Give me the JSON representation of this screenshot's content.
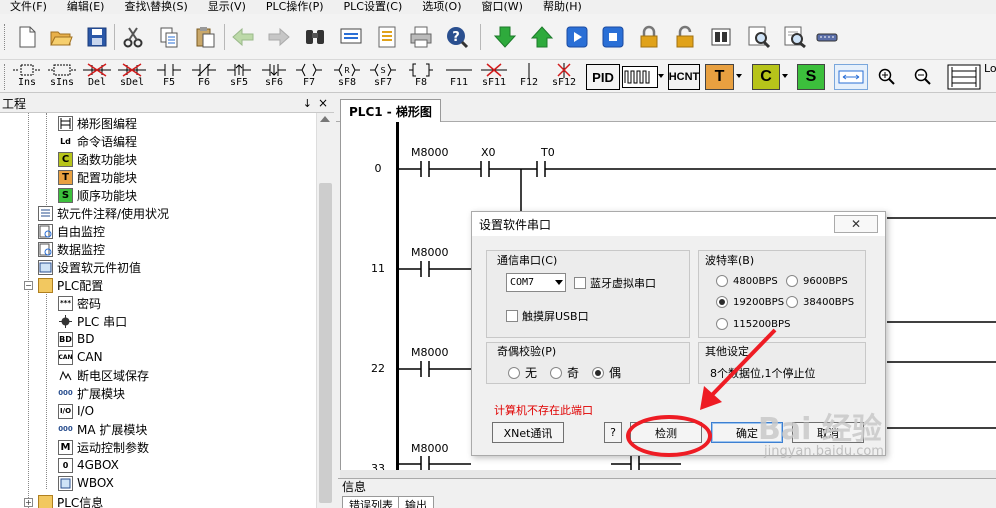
{
  "menu": {
    "items": [
      "文件(F)",
      "编辑(E)",
      "查找\\替换(S)",
      "显示(V)",
      "PLC操作(P)",
      "PLC设置(C)",
      "选项(O)",
      "窗口(W)",
      "帮助(H)"
    ]
  },
  "toolbar1": {
    "icons": [
      "new-file-icon",
      "open-folder-icon",
      "save-icon",
      "cut-icon",
      "copy-icon",
      "paste-icon",
      "back-arrow-icon",
      "forward-arrow-icon",
      "find-icon",
      "monitor-icon",
      "document-icon",
      "print-icon",
      "help-icon",
      "download-arrow-icon",
      "upload-arrow-icon",
      "run-icon",
      "stop-icon",
      "lock-icon",
      "unlock-icon",
      "panel-icon",
      "zoom-doc-icon",
      "search-doc-icon",
      "port-icon"
    ],
    "colors": {
      "green": "#2eaa3c",
      "blue": "#2a6fd6",
      "gold": "#e0a21a"
    }
  },
  "toolbar2": {
    "ladder_buttons": [
      {
        "label": "Ins",
        "icon": "insert-icon"
      },
      {
        "label": "sIns",
        "icon": "shift-insert-icon"
      },
      {
        "label": "Del",
        "icon": "delete-icon"
      },
      {
        "label": "sDel",
        "icon": "shift-delete-icon"
      },
      {
        "label": "F5",
        "icon": "contact-no-icon"
      },
      {
        "label": "F6",
        "icon": "contact-nc-icon"
      },
      {
        "label": "sF5",
        "icon": "rising-edge-icon"
      },
      {
        "label": "sF6",
        "icon": "falling-edge-icon"
      },
      {
        "label": "F7",
        "icon": "coil-icon"
      },
      {
        "label": "sF8",
        "icon": "reset-coil-icon"
      },
      {
        "label": "sF7",
        "icon": "set-coil-icon"
      },
      {
        "label": "F8",
        "icon": "instruction-icon"
      },
      {
        "label": "F11",
        "icon": "hline-icon"
      },
      {
        "label": "sF11",
        "icon": "delete-hline-icon"
      },
      {
        "label": "F12",
        "icon": "vline-icon"
      },
      {
        "label": "sF12",
        "icon": "delete-vline-icon"
      }
    ],
    "pid_label": "PID",
    "hcnt_label": "HCNT",
    "t_label": "T",
    "c_label": "C",
    "s_label": "S",
    "lo_label": "Lo"
  },
  "project": {
    "header": "工程",
    "pin": "↓",
    "close": "×",
    "items": [
      {
        "label": "梯形图编程",
        "icon_text": "",
        "icon": "ladder-program-icon"
      },
      {
        "label": "命令语编程",
        "icon_text": "Ld",
        "icon": "command-program-icon"
      },
      {
        "label": "函数功能块",
        "icon_text": "C",
        "icon": "function-block-icon"
      },
      {
        "label": "配置功能块",
        "icon_text": "T",
        "icon": "config-block-icon"
      },
      {
        "label": "顺序功能块",
        "icon_text": "S",
        "icon": "sequence-block-icon"
      },
      {
        "label": "软元件注释/使用状况",
        "icon_text": "",
        "icon": "comment-icon"
      },
      {
        "label": "自由监控",
        "icon_text": "",
        "icon": "free-monitor-icon"
      },
      {
        "label": "数据监控",
        "icon_text": "",
        "icon": "data-monitor-icon"
      },
      {
        "label": "设置软元件初值",
        "icon_text": "",
        "icon": "init-value-icon"
      },
      {
        "label": "PLC配置",
        "icon_text": "",
        "icon": "folder-icon"
      },
      {
        "label": "密码",
        "icon_text": "***",
        "icon": "password-icon"
      },
      {
        "label": "PLC 串口",
        "icon_text": "",
        "icon": "serial-port-icon"
      },
      {
        "label": "BD",
        "icon_text": "BD",
        "icon": "bd-icon"
      },
      {
        "label": "CAN",
        "icon_text": "CAN",
        "icon": "can-icon"
      },
      {
        "label": "断电区域保存",
        "icon_text": "",
        "icon": "power-save-icon"
      },
      {
        "label": "扩展模块",
        "icon_text": "000",
        "icon": "expansion-module-icon"
      },
      {
        "label": "I/O",
        "icon_text": "I/O",
        "icon": "io-icon"
      },
      {
        "label": "MA 扩展模块",
        "icon_text": "000",
        "icon": "ma-module-icon"
      },
      {
        "label": "运动控制参数",
        "icon_text": "M",
        "icon": "motion-control-icon"
      },
      {
        "label": "4GBOX",
        "icon_text": "0",
        "icon": "4gbox-icon"
      },
      {
        "label": "WBOX",
        "icon_text": "",
        "icon": "wbox-icon"
      },
      {
        "label": "PLC信息",
        "icon_text": "",
        "icon": "folder-icon"
      }
    ]
  },
  "ladder": {
    "tab_label": "PLC1 - 梯形图",
    "rungs": [
      {
        "num": "0",
        "contacts": [
          "M8000",
          "X0",
          "T0"
        ]
      },
      {
        "num": "11",
        "contacts": [
          "M8000"
        ]
      },
      {
        "num": "22",
        "contacts": [
          "M8000"
        ]
      },
      {
        "num": "33",
        "contacts": [
          "M8000"
        ]
      }
    ]
  },
  "info": {
    "header": "信息",
    "tabs": [
      "错误列表",
      "输出"
    ]
  },
  "dialog": {
    "title": "设置软件串口",
    "close": "✕",
    "comm_port_title": "通信串口(C)",
    "comm_port_value": "COM7",
    "bt_label": "蓝牙虚拟串口",
    "usb_label": "触摸屏USB口",
    "baud_title": "波特率(B)",
    "baud_options": [
      "4800BPS",
      "9600BPS",
      "19200BPS",
      "38400BPS",
      "115200BPS"
    ],
    "baud_selected": "19200BPS",
    "parity_title": "奇偶校验(P)",
    "parity_options": [
      "无",
      "奇",
      "偶"
    ],
    "parity_selected": "偶",
    "other_title": "其他设定",
    "other_value": "8个数据位,1个停止位",
    "error_text": "计算机不存在此端口",
    "xnet_label": "XNet通讯",
    "help_label": "?",
    "detect_label": "检测",
    "ok_label": "确定",
    "cancel_label": "取消"
  },
  "annotation": {
    "color": "#ee1c24"
  },
  "watermark": {
    "text": "Bai 经验",
    "url": "jingyan.baidu.com"
  }
}
